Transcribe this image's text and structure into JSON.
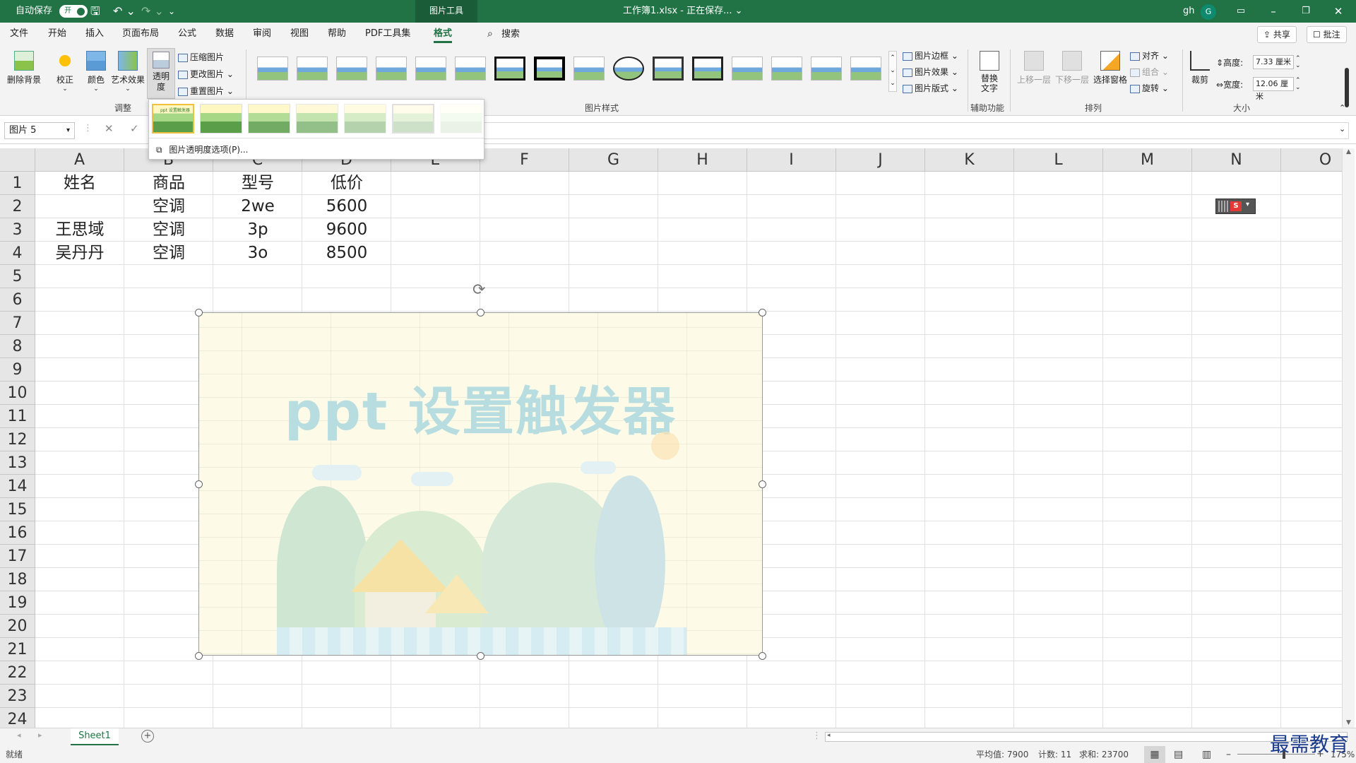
{
  "titlebar": {
    "autosave_label": "自动保存",
    "autosave_state": "开",
    "context_tab": "图片工具",
    "document_title": "工作簿1.xlsx - 正在保存... ⌄",
    "user": "gh",
    "avatar_initial": "G"
  },
  "menu": {
    "tabs": [
      "文件",
      "开始",
      "插入",
      "页面布局",
      "公式",
      "数据",
      "审阅",
      "视图",
      "帮助",
      "PDF工具集",
      "格式"
    ],
    "active": "格式",
    "search_label": "搜索",
    "share_label": "共享",
    "comments_label": "批注"
  },
  "ribbon": {
    "adjust": {
      "remove_background": "删除背景",
      "corrections": "校正",
      "color": "颜色",
      "artistic_effects": "艺术效果",
      "transparency": "透明度",
      "compress": "压缩图片",
      "change": "更改图片",
      "reset": "重置图片",
      "group_label": "调整"
    },
    "styles": {
      "group_label": "图片样式",
      "border": "图片边框",
      "effects": "图片效果",
      "layout": "图片版式"
    },
    "accessibility": {
      "alt_text_line1": "替换",
      "alt_text_line2": "文字",
      "group_label": "辅助功能"
    },
    "arrange": {
      "bring_forward": "上移一层",
      "send_backward": "下移一层",
      "selection_pane": "选择窗格",
      "align": "对齐",
      "group": "组合",
      "rotate": "旋转",
      "group_label": "排列"
    },
    "size": {
      "crop": "裁剪",
      "height_label": "高度:",
      "height_value": "7.33 厘米",
      "width_label": "宽度:",
      "width_value": "12.06 厘米",
      "group_label": "大小"
    }
  },
  "dropdown": {
    "thumb_label": "ppt 设置触发器",
    "option": "图片透明度选项(P)..."
  },
  "formula": {
    "name_box": "图片 5",
    "cancel": "✕",
    "enter": "✓"
  },
  "grid": {
    "columns": [
      "A",
      "B",
      "C",
      "D",
      "E",
      "F",
      "G",
      "H",
      "I",
      "J",
      "K",
      "L",
      "M",
      "N",
      "O"
    ],
    "rows": [
      "1",
      "2",
      "3",
      "4",
      "5",
      "6",
      "7",
      "8",
      "9",
      "10",
      "11",
      "12",
      "13",
      "14",
      "15",
      "16",
      "17",
      "18",
      "19",
      "20",
      "21",
      "22",
      "23",
      "24"
    ],
    "cells": [
      [
        "姓名",
        "商品",
        "型号",
        "低价"
      ],
      [
        "",
        "空调",
        "2we",
        "5600"
      ],
      [
        "王思域",
        "空调",
        "3p",
        "9600"
      ],
      [
        "吴丹丹",
        "空调",
        "3o",
        "8500"
      ]
    ]
  },
  "picture": {
    "title": "ppt 设置触发器"
  },
  "sheet_tabs": [
    "Sheet1"
  ],
  "status": {
    "ready": "就绪",
    "average": "平均值: 7900",
    "count": "计数: 11",
    "sum": "求和: 23700",
    "zoom": "175%"
  },
  "watermark": "最需教育"
}
